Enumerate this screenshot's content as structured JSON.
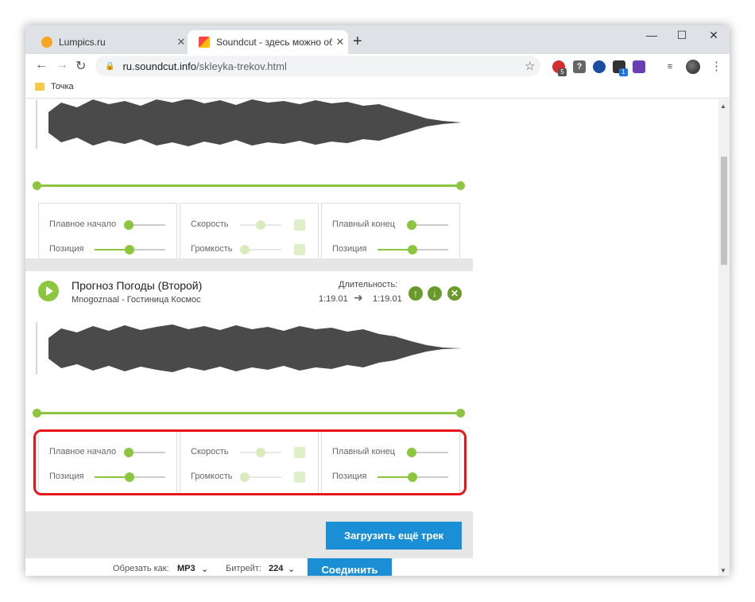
{
  "tabs": [
    {
      "title": "Lumpics.ru",
      "close": "✕"
    },
    {
      "title": "Soundcut - здесь можно обреза",
      "close": "✕"
    }
  ],
  "new_tab": "+",
  "window_controls": {
    "minimize": "—",
    "maximize": "☐",
    "close": "✕"
  },
  "nav": {
    "back": "←",
    "forward": "→",
    "reload": "↻"
  },
  "omnibox": {
    "host": "ru.soundcut.info",
    "path": "/skleyka-trekov.html"
  },
  "extensions": {
    "badge_1": "5",
    "badge_2": "1",
    "help": "?"
  },
  "bookmark": {
    "label": "Точка"
  },
  "track1": {
    "controls": {
      "fade_in": "Плавное начало",
      "position": "Позиция",
      "speed": "Скорость",
      "volume": "Громкость",
      "fade_out": "Плавный конец",
      "position2": "Позиция"
    }
  },
  "track2": {
    "title": "Прогноз Погоды (Второй)",
    "artist": "Mnogoznaal - Гостиница Космос",
    "duration_label": "Длительность:",
    "duration_from": "1:19.01",
    "duration_to": "1:19.01",
    "controls": {
      "fade_in": "Плавное начало",
      "position": "Позиция",
      "speed": "Скорость",
      "volume": "Громкость",
      "fade_out": "Плавный конец",
      "position2": "Позиция"
    }
  },
  "upload_more": "Загрузить ещё трек",
  "bottom": {
    "cut_as_label": "Обрезать как:",
    "cut_as_value": "MP3",
    "bitrate_label": "Битрейт:",
    "bitrate_value": "224",
    "join_button": "Соединить"
  },
  "colors": {
    "accent_green": "#8cc63f",
    "button_blue": "#1a8fd6",
    "highlight_red": "#e8161b"
  }
}
